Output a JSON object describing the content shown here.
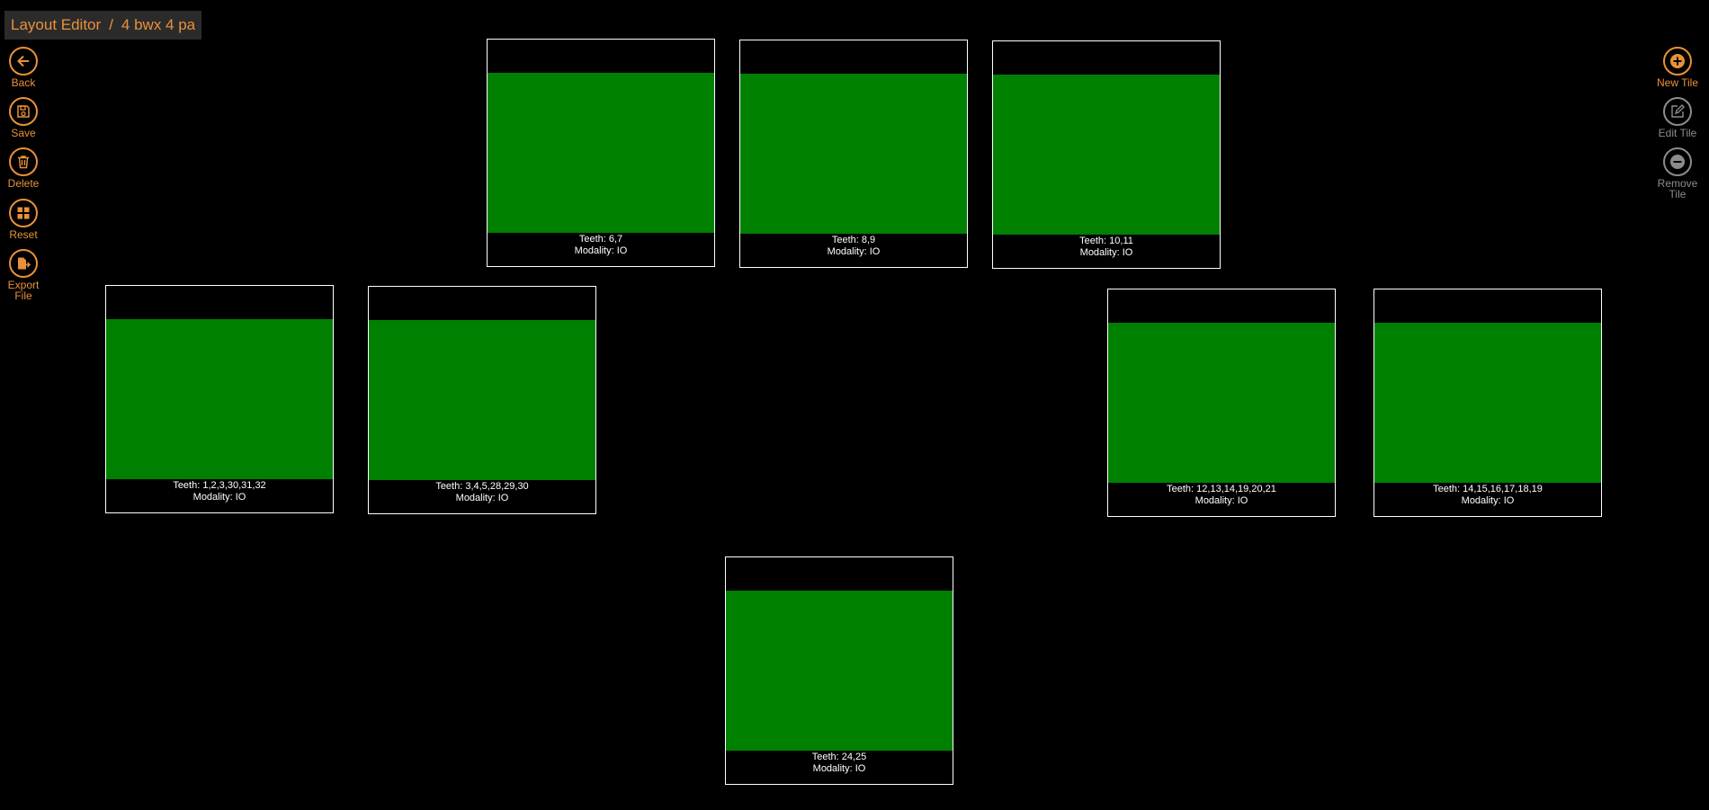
{
  "breadcrumb": {
    "app": "Layout Editor",
    "separator": "/",
    "layout_name": "4 bwx 4 pa"
  },
  "left_commands": [
    {
      "label": "Back",
      "icon": "arrow-left-icon"
    },
    {
      "label": "Save",
      "icon": "save-icon"
    },
    {
      "label": "Delete",
      "icon": "trash-icon"
    },
    {
      "label": "Reset",
      "icon": "grid-icon"
    },
    {
      "label": "Export\nFile",
      "icon": "export-file-icon"
    }
  ],
  "right_commands": [
    {
      "label": "New Tile",
      "icon": "plus-icon",
      "enabled": true
    },
    {
      "label": "Edit Tile",
      "icon": "edit-icon",
      "enabled": false
    },
    {
      "label": "Remove\nTile",
      "icon": "minus-icon",
      "enabled": false
    }
  ],
  "tiles": [
    {
      "teeth": "Teeth: 6,7",
      "modality": "Modality: IO"
    },
    {
      "teeth": "Teeth: 8,9",
      "modality": "Modality: IO"
    },
    {
      "teeth": "Teeth: 10,11",
      "modality": "Modality: IO"
    },
    {
      "teeth": "Teeth: 1,2,3,30,31,32",
      "modality": "Modality: IO"
    },
    {
      "teeth": "Teeth: 3,4,5,28,29,30",
      "modality": "Modality: IO"
    },
    {
      "teeth": "Teeth: 12,13,14,19,20,21",
      "modality": "Modality: IO"
    },
    {
      "teeth": "Teeth: 14,15,16,17,18,19",
      "modality": "Modality: IO"
    },
    {
      "teeth": "Teeth: 24,25",
      "modality": "Modality: IO"
    }
  ],
  "colors": {
    "accent": "#e8913a",
    "disabled": "#8c8c8c",
    "tile_image": "#008000",
    "background": "#000000"
  }
}
